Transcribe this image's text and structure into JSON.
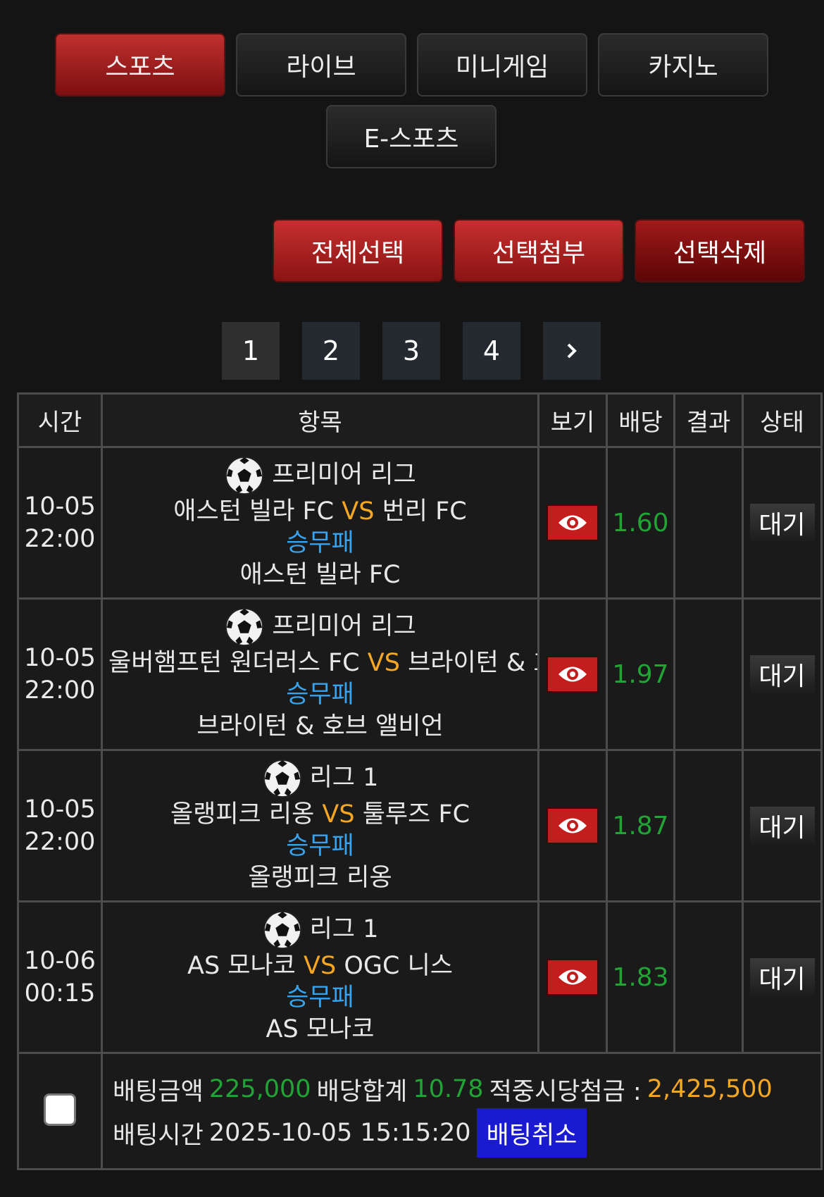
{
  "tabs": [
    "스포츠",
    "라이브",
    "미니게임",
    "카지노",
    "E-스포츠"
  ],
  "actions": [
    "전체선택",
    "선택첨부",
    "선택삭제"
  ],
  "pagination": {
    "pages": [
      "1",
      "2",
      "3",
      "4"
    ],
    "current": "1",
    "next_icon": "chevron-right"
  },
  "table": {
    "headers": [
      "시간",
      "항목",
      "보기",
      "배당",
      "결과",
      "상태"
    ],
    "rows": [
      {
        "date": "10-05",
        "time": "22:00",
        "league": "프리미어 리그",
        "home": "애스턴 빌라 FC",
        "vs": "VS",
        "away": "번리 FC",
        "market": "승무패",
        "pick": "애스턴 빌라 FC",
        "odds": "1.60",
        "result": "",
        "status": "대기"
      },
      {
        "date": "10-05",
        "time": "22:00",
        "league": "프리미어 리그",
        "home": "울버햄프턴 원더러스 FC",
        "vs": "VS",
        "away": "브라이턴 & 호브 앨비언",
        "market": "승무패",
        "pick": "브라이턴 & 호브 앨비언",
        "odds": "1.97",
        "result": "",
        "status": "대기"
      },
      {
        "date": "10-05",
        "time": "22:00",
        "league": "리그 1",
        "home": "올랭피크 리옹",
        "vs": "VS",
        "away": "툴루즈 FC",
        "market": "승무패",
        "pick": "올랭피크 리옹",
        "odds": "1.87",
        "result": "",
        "status": "대기"
      },
      {
        "date": "10-06",
        "time": "00:15",
        "league": "리그 1",
        "home": "AS 모나코",
        "vs": "VS",
        "away": "OGC 니스",
        "market": "승무패",
        "pick": "AS 모나코",
        "odds": "1.83",
        "result": "",
        "status": "대기"
      }
    ]
  },
  "summary": {
    "amount_label": "배팅금액",
    "amount": "225,000",
    "odds_label": "배당합계",
    "odds_total": "10.78",
    "payout_label": "적중시당첨금 :",
    "payout": "2,425,500",
    "time_label": "배팅시간",
    "time": "2025-10-05 15:15:20",
    "cancel_label": "배팅취소"
  },
  "colors": {
    "accent_red": "#c0302f",
    "odds_green": "#22a336",
    "vs_orange": "#f5a623",
    "market_blue": "#36a3f0",
    "cancel_blue": "#1a1ad0"
  }
}
